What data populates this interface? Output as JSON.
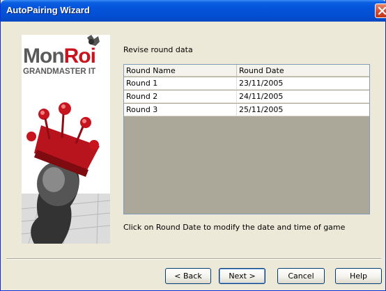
{
  "window": {
    "title": "AutoPairing Wizard"
  },
  "logo": {
    "brand_prefix": "Mon",
    "brand_accent": "Roi",
    "tagline": "GRANDMASTER IT"
  },
  "main": {
    "instruction": "Revise round data",
    "hint": "Click on Round Date to modify the date and time of game"
  },
  "grid": {
    "columns": [
      "Round Name",
      "Round Date"
    ],
    "rows": [
      [
        "Round 1",
        "23/11/2005"
      ],
      [
        "Round 2",
        "24/11/2005"
      ],
      [
        "Round 3",
        "25/11/2005"
      ]
    ]
  },
  "buttons": {
    "back": "< Back",
    "next": "Next >",
    "cancel": "Cancel",
    "help": "Help"
  },
  "colors": {
    "title_bar": "#0453d9",
    "brand_red": "#c8141e",
    "grid_empty": "#aca899"
  }
}
